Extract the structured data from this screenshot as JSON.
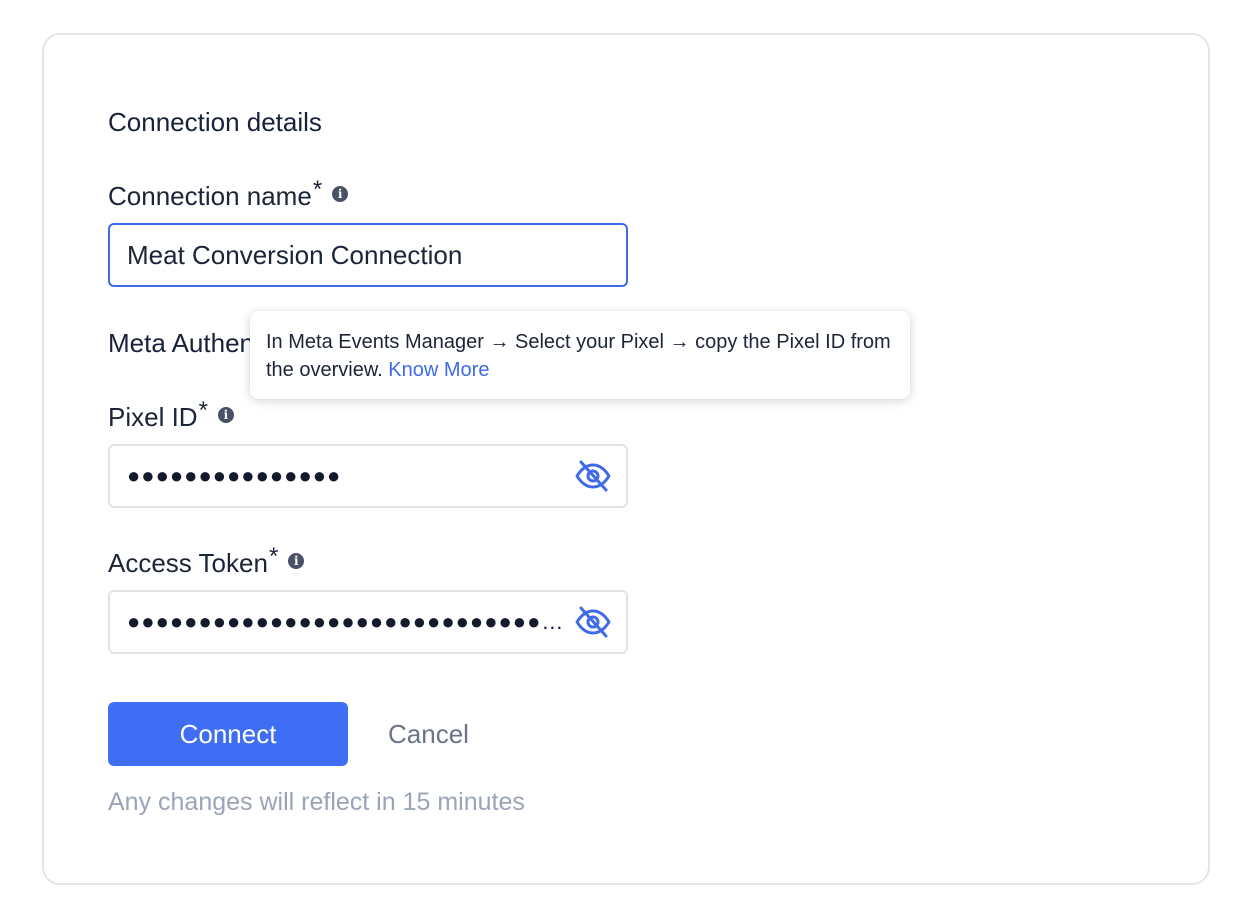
{
  "section": {
    "connection_details": "Connection details",
    "meta_auth": "Meta Authentication"
  },
  "fields": {
    "connection_name": {
      "label": "Connection name",
      "required_mark": "*",
      "value": "Meat Conversion Connection"
    },
    "pixel_id": {
      "label": "Pixel ID",
      "required_mark": "*",
      "masked_value": "●●●●●●●●●●●●●●●"
    },
    "access_token": {
      "label": "Access Token",
      "required_mark": "*",
      "masked_value": "●●●●●●●●●●●●●●●●●●●●●●●●●●●●●●●●"
    }
  },
  "tooltip": {
    "text": "In Meta Events Manager → Select your Pixel → copy the Pixel ID from the overview.",
    "link": "Know More"
  },
  "buttons": {
    "connect": "Connect",
    "cancel": "Cancel"
  },
  "hint": "Any changes will reflect in 15 minutes",
  "icons": {
    "info": "info-icon",
    "toggle_visibility": "eye-off-icon"
  },
  "colors": {
    "accent": "#3f6ef5",
    "link": "#3f6be8",
    "hint": "#9aa3b8"
  }
}
